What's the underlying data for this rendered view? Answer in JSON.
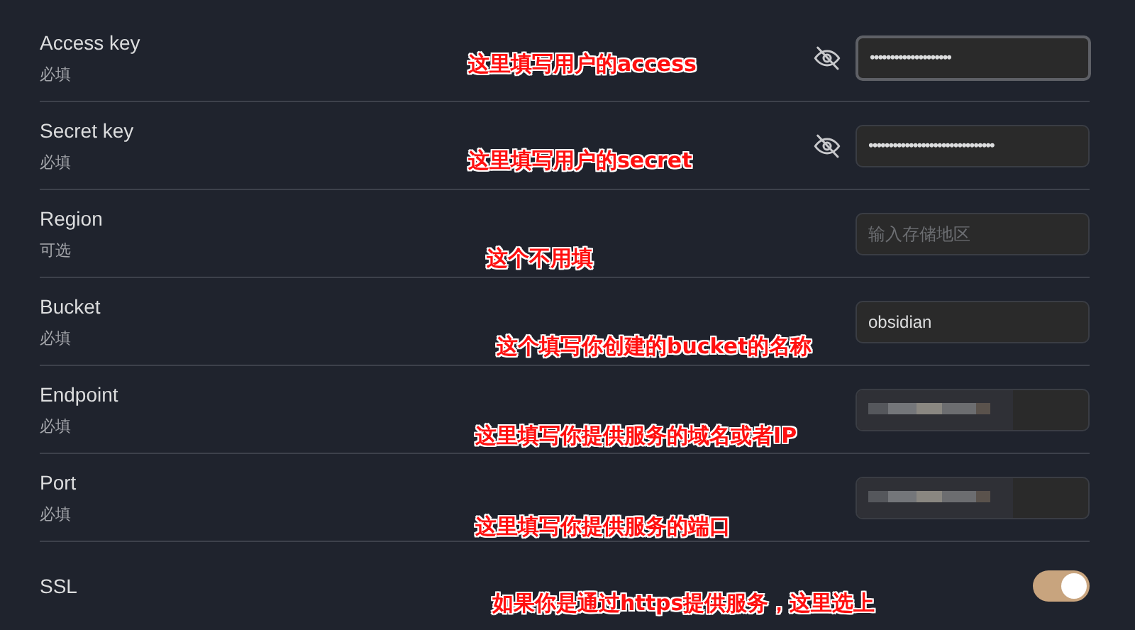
{
  "settings": [
    {
      "kind": "input",
      "label": "Access key",
      "description": "必填",
      "annotation": "这里填写用户的access",
      "field": {
        "kind": "password",
        "value": "••••••••••••••••••••",
        "focused": true
      }
    },
    {
      "kind": "input",
      "label": "Secret key",
      "description": "必填",
      "annotation": "这里填写用户的secret",
      "field": {
        "kind": "password",
        "value": "•••••••••••••••••••••••••••••••",
        "focused": false
      }
    },
    {
      "kind": "input",
      "label": "Region",
      "description": "可选",
      "annotation": "这个不用填",
      "field": {
        "kind": "empty",
        "placeholder": "输入存储地区",
        "focused": false
      }
    },
    {
      "kind": "input",
      "label": "Bucket",
      "description": "必填",
      "annotation": "这个填写你创建的bucket的名称",
      "field": {
        "kind": "text",
        "value": "obsidian",
        "focused": false
      }
    },
    {
      "kind": "input",
      "label": "Endpoint",
      "description": "必填",
      "annotation": "这里填写你提供服务的域名或者IP",
      "field": {
        "kind": "redacted",
        "focused": false
      }
    },
    {
      "kind": "input",
      "label": "Port",
      "description": "必填",
      "annotation": "这里填写你提供服务的端口",
      "field": {
        "kind": "redacted",
        "focused": false
      }
    },
    {
      "kind": "toggle",
      "label": "SSL",
      "annotation": "如果你是通过https提供服务，这里选上",
      "on": true
    }
  ]
}
